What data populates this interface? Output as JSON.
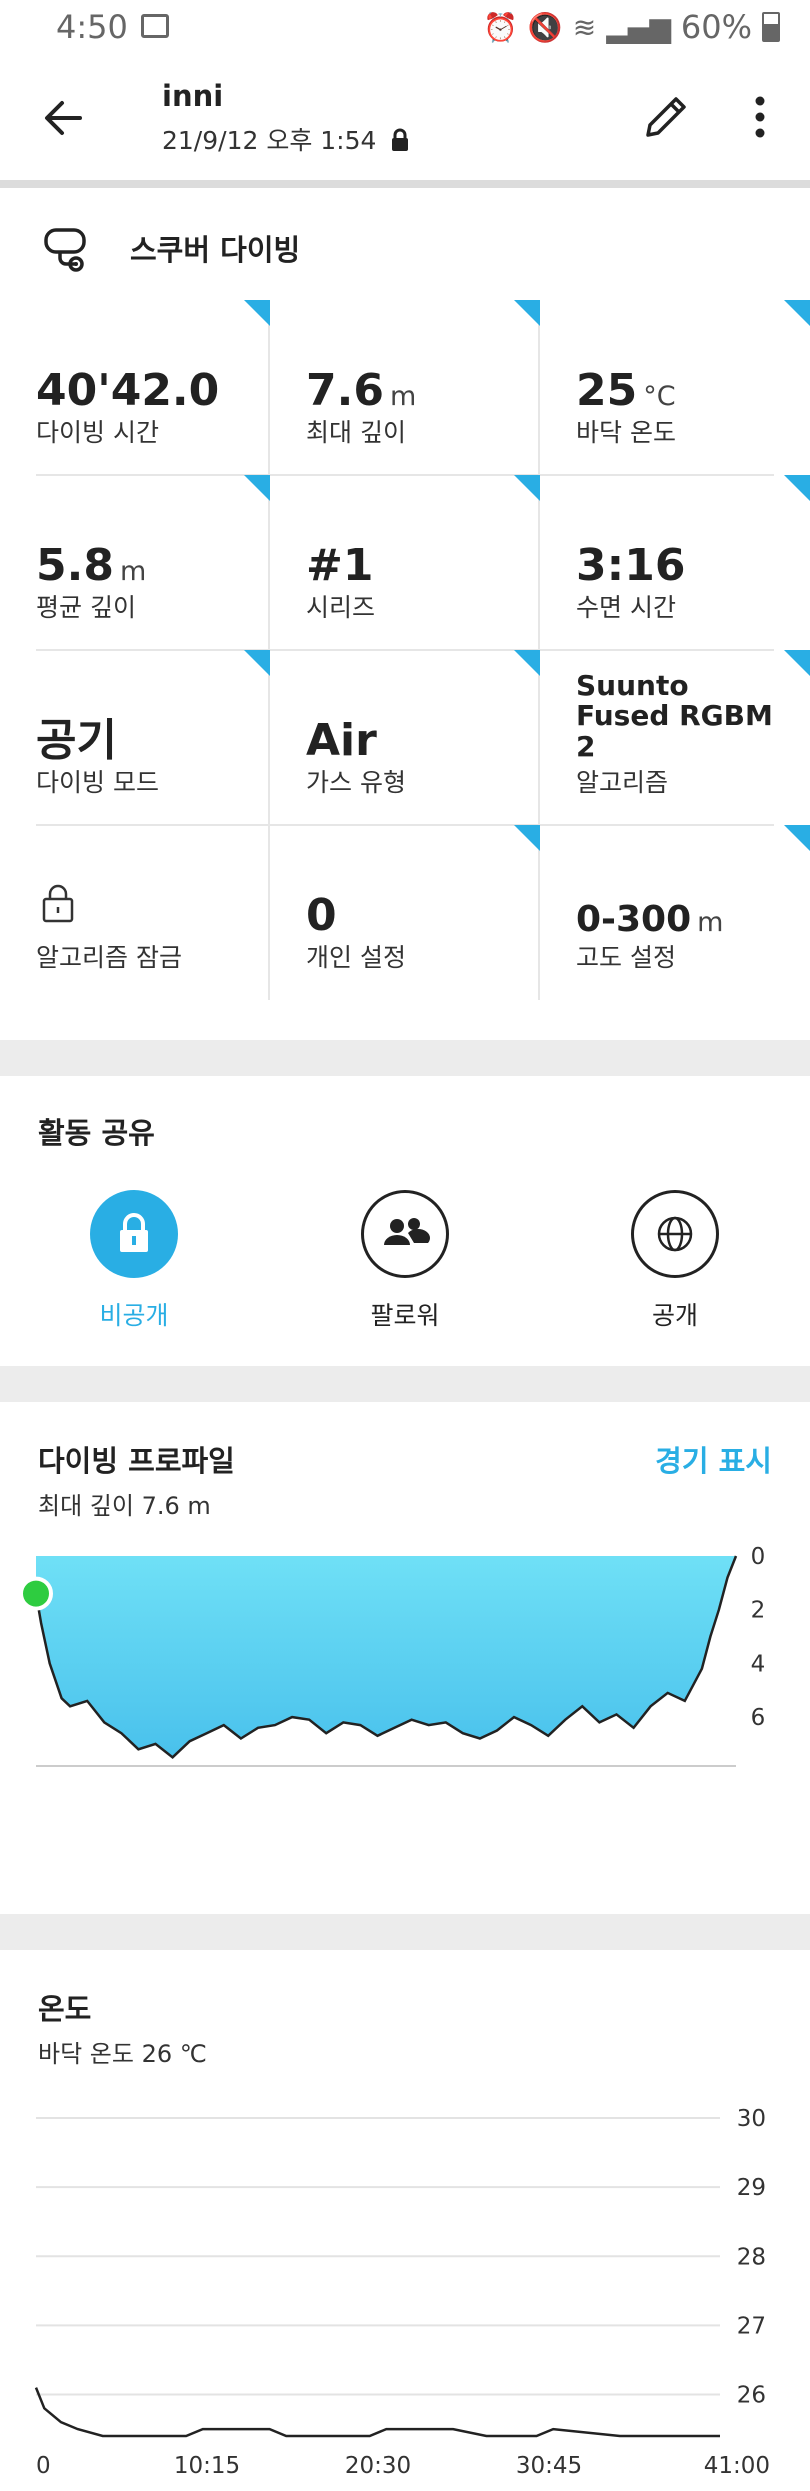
{
  "status_bar": {
    "time": "4:50",
    "battery": "60%"
  },
  "header": {
    "title": "inni",
    "subtitle": "21/9/12 오후 1:54"
  },
  "activity": {
    "type_label": "스쿠버 다이빙"
  },
  "stats": [
    {
      "value": "40'42.0",
      "unit": "",
      "label": "다이빙 시간"
    },
    {
      "value": "7.6",
      "unit": "m",
      "label": "최대 깊이"
    },
    {
      "value": "25",
      "unit": "°C",
      "label": "바닥 온도"
    },
    {
      "value": "5.8",
      "unit": "m",
      "label": "평균 깊이"
    },
    {
      "value": "#1",
      "unit": "",
      "label": "시리즈"
    },
    {
      "value": "3:16",
      "unit": "",
      "label": "수면 시간"
    },
    {
      "value": "공기",
      "unit": "",
      "label": "다이빙 모드"
    },
    {
      "value": "Air",
      "unit": "",
      "label": "가스 유형"
    },
    {
      "value": "Suunto Fused RGBM 2",
      "unit": "",
      "label": "알고리즘"
    },
    {
      "value": "",
      "unit": "",
      "label": "알고리즘 잠금"
    },
    {
      "value": "0",
      "unit": "",
      "label": "개인 설정"
    },
    {
      "value": "0-300",
      "unit": "m",
      "label": "고도 설정"
    }
  ],
  "sharing": {
    "title": "활동 공유",
    "options": [
      {
        "label": "비공개",
        "icon": "lock-icon",
        "selected": true
      },
      {
        "label": "팔로워",
        "icon": "followers-icon",
        "selected": false
      },
      {
        "label": "공개",
        "icon": "globe-icon",
        "selected": false
      }
    ]
  },
  "dive_profile": {
    "title": "다이빙 프로파일",
    "subtitle": "최대 깊이 7.6 m",
    "link": "경기 표시"
  },
  "temperature": {
    "title": "온도",
    "subtitle": "바닥 온도 26 ℃"
  },
  "colors": {
    "accent": "#29aee4",
    "profile_fill": "#5dd0ef",
    "marker": "#2ecc40"
  },
  "chart_data": [
    {
      "type": "area",
      "y_inverted": true,
      "x_ticks": [
        "0",
        "10:15",
        "20:30",
        "30:45",
        "41:00"
      ],
      "y_ticks": [
        "0",
        "2",
        "4",
        "6"
      ],
      "ylim": [
        0,
        7.6
      ],
      "xlim": [
        0,
        41.0
      ],
      "series": [
        {
          "x": [
            0,
            0.3,
            0.8,
            1.5,
            2,
            3,
            4,
            5,
            6,
            7,
            8,
            9,
            10,
            11,
            12,
            13,
            14,
            15,
            16,
            17,
            18,
            19,
            20,
            21,
            22,
            23,
            24,
            25,
            26,
            27,
            28,
            29,
            30,
            31,
            32,
            33,
            34,
            35,
            36,
            37,
            38,
            39,
            39.5,
            40,
            40.5,
            41
          ],
          "y": [
            1.4,
            2.5,
            4.0,
            5.3,
            5.6,
            5.4,
            6.2,
            6.6,
            7.2,
            7.0,
            7.5,
            6.9,
            6.6,
            6.3,
            6.8,
            6.4,
            6.3,
            6.0,
            6.1,
            6.6,
            6.2,
            6.3,
            6.7,
            6.4,
            6.1,
            6.3,
            6.2,
            6.6,
            6.8,
            6.5,
            6.0,
            6.3,
            6.7,
            6.1,
            5.6,
            6.2,
            5.9,
            6.4,
            5.6,
            5.1,
            5.4,
            4.2,
            3.0,
            2.0,
            0.8,
            0
          ]
        }
      ]
    },
    {
      "type": "line",
      "x_ticks": [
        "0",
        "10:15",
        "20:30",
        "30:45",
        "41:00"
      ],
      "y_ticks": [
        "30",
        "29",
        "28",
        "27",
        "26"
      ],
      "ylim": [
        25.4,
        30
      ],
      "xlim": [
        0,
        41.0
      ],
      "series": [
        {
          "x": [
            0,
            0.5,
            1.5,
            2.5,
            4,
            6,
            9,
            10,
            14,
            15,
            20,
            21,
            25,
            27,
            30,
            31,
            35,
            38,
            41
          ],
          "y": [
            26.1,
            25.8,
            25.6,
            25.5,
            25.4,
            25.4,
            25.4,
            25.5,
            25.5,
            25.4,
            25.4,
            25.5,
            25.5,
            25.4,
            25.4,
            25.5,
            25.4,
            25.4,
            25.4
          ]
        }
      ]
    }
  ]
}
